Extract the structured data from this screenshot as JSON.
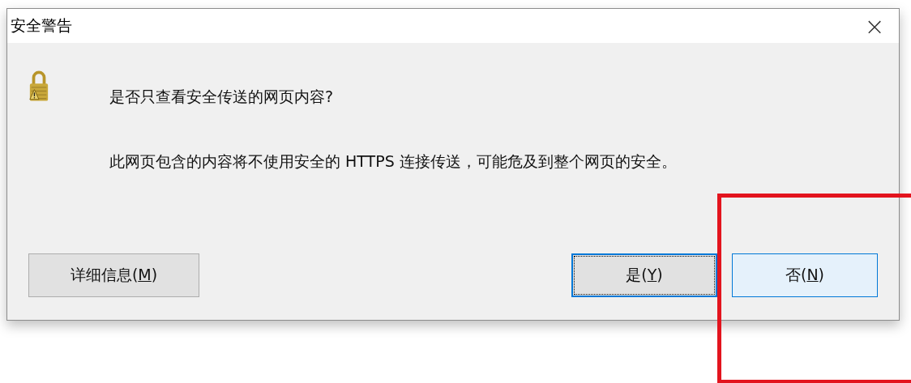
{
  "window": {
    "title": "安全警告",
    "close": "×"
  },
  "message": {
    "question": "是否只查看安全传送的网页内容?",
    "detail": "此网页包含的内容将不使用安全的 HTTPS 连接传送，可能危及到整个网页的安全。"
  },
  "buttons": [
    {
      "text_before": "详细信息(",
      "access_key": "M",
      "text_after": ")",
      "focused": false,
      "hovered": false
    },
    {
      "text_before": "是(",
      "access_key": "Y",
      "text_after": ")",
      "focused": true,
      "hovered": false
    },
    {
      "text_before": "否(",
      "access_key": "N",
      "text_after": ")",
      "focused": false,
      "hovered": true
    }
  ],
  "annotations": [
    {
      "kind": "frame",
      "color": "#e3141e"
    }
  ]
}
